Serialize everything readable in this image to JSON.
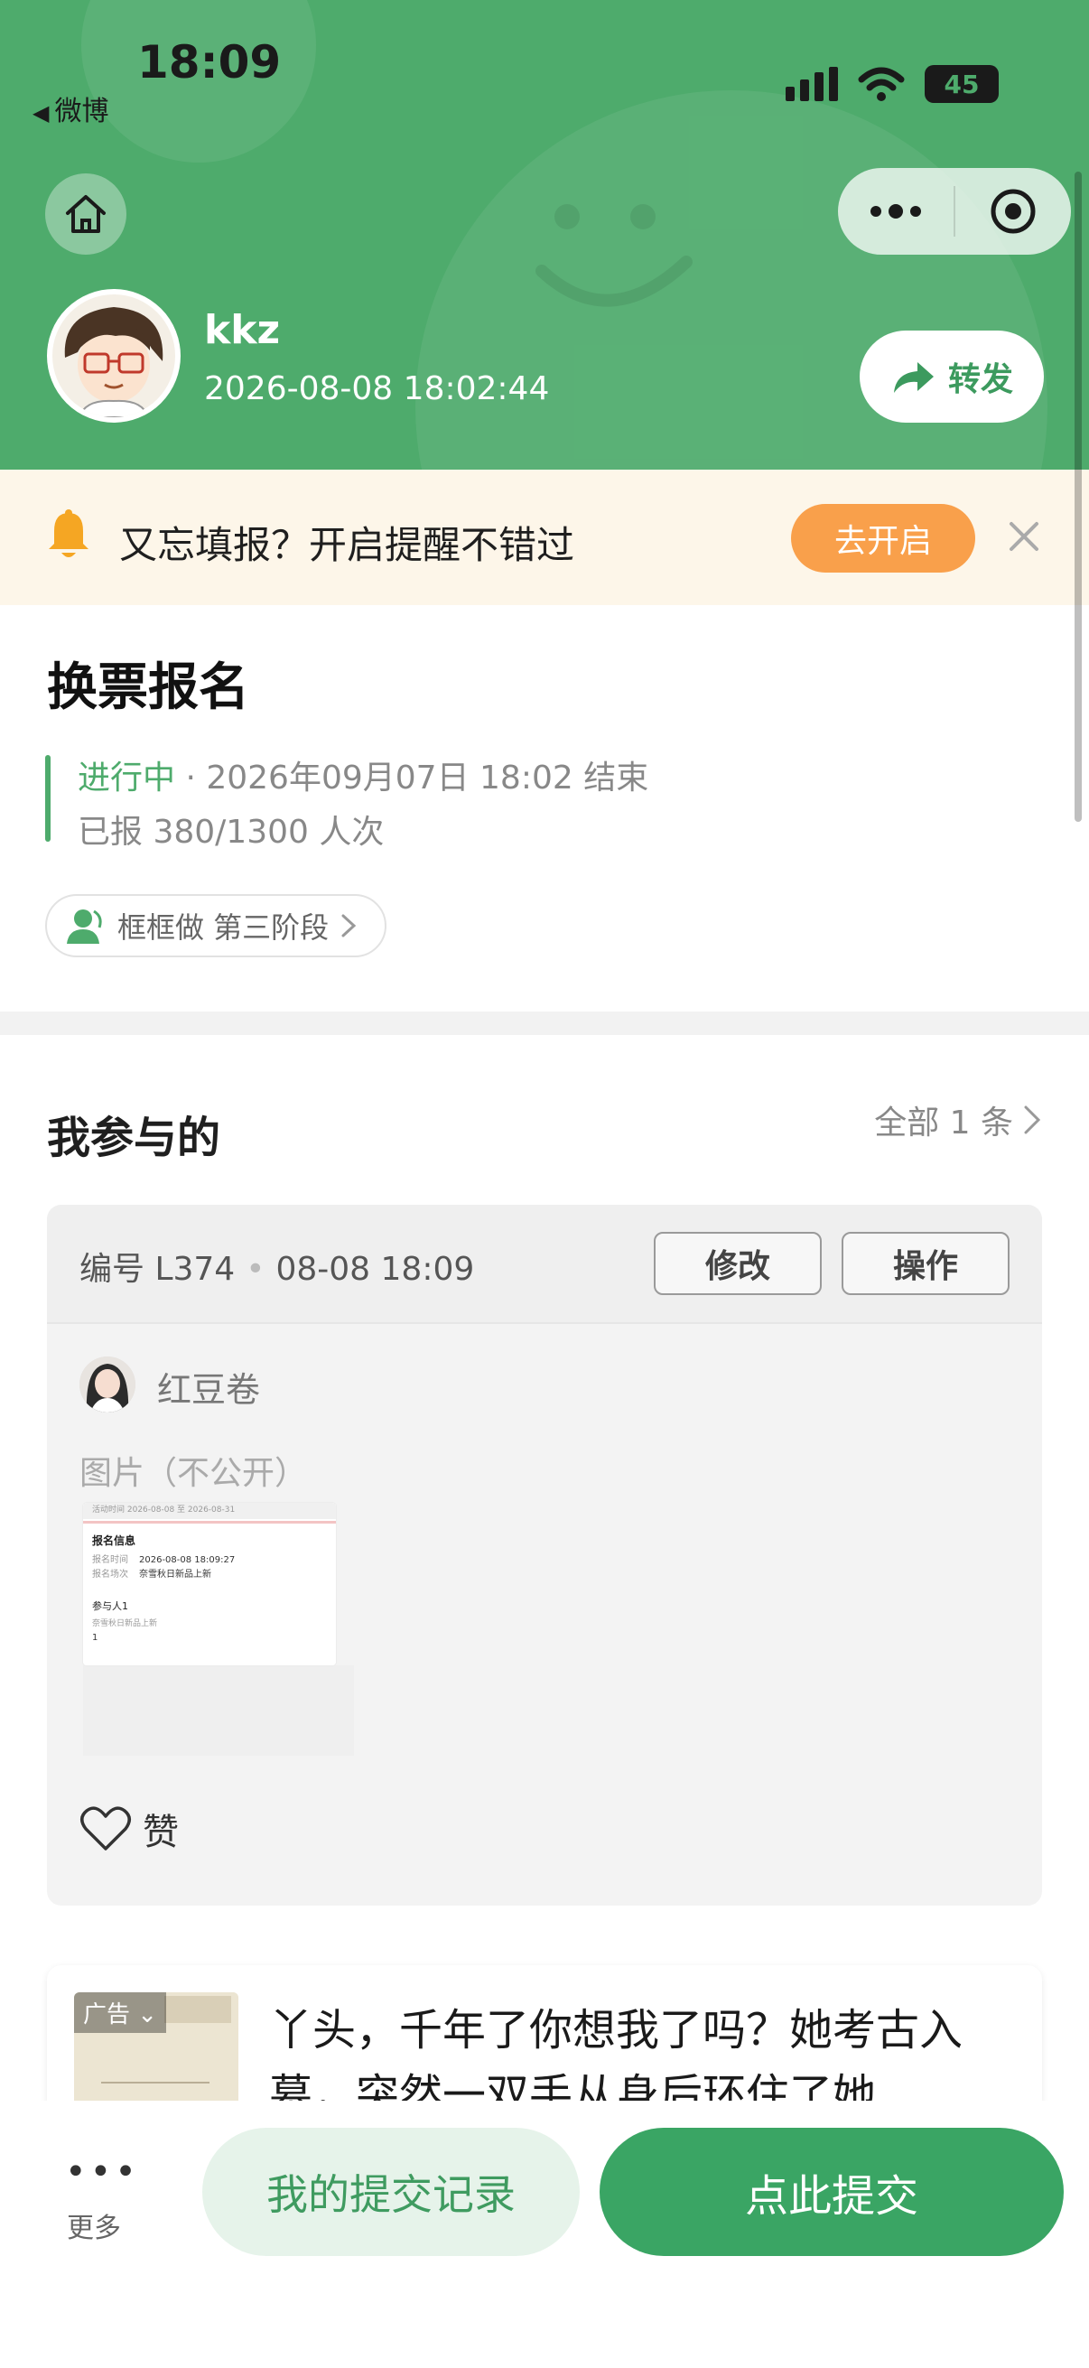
{
  "status_bar": {
    "time": "18:09",
    "back_app": "微博",
    "battery": "45"
  },
  "header": {
    "user_name": "kkz",
    "post_time": "2026-08-08 18:02:44",
    "share_label": "转发"
  },
  "reminder": {
    "text": "又忘填报？开启提醒不错过",
    "button": "去开启"
  },
  "event": {
    "title": "换票报名",
    "status": "进行中",
    "end_info": " · 2026年09月07日 18:02 结束",
    "reported": "已报 380/1300 人次",
    "organizer": "框框做 第三阶段"
  },
  "my_participation": {
    "title": "我参与的",
    "all_link": "全部 1 条",
    "entry": {
      "number": "编号 L374",
      "time": "08-08 18:09",
      "edit_label": "修改",
      "op_label": "操作",
      "user": "红豆卷",
      "image_label": "图片（不公开）",
      "like_label": "赞",
      "thumb": {
        "line0": "活动时间   2026-08-08 至 2026-08-31",
        "heading": "报名信息",
        "row1_label": "报名时间",
        "row1_value": "2026-08-08 18:09:27",
        "row2_label": "报名场次",
        "row2_value": "奈雪秋日新品上新",
        "participant_heading": "参与人1",
        "participant_sub": "奈雪秋日新品上新",
        "participant_num": "1"
      }
    }
  },
  "ad": {
    "tag": "广告",
    "text": "丫头，千年了你想我了吗？她考古入墓，突然一双手从身后环住了她"
  },
  "bottom": {
    "more_label": "更多",
    "records_label": "我的提交记录",
    "submit_label": "点此提交"
  },
  "colors": {
    "brand_green": "#4eab6c",
    "submit_green": "#3aa564",
    "reminder_orange": "#f9a04b"
  }
}
